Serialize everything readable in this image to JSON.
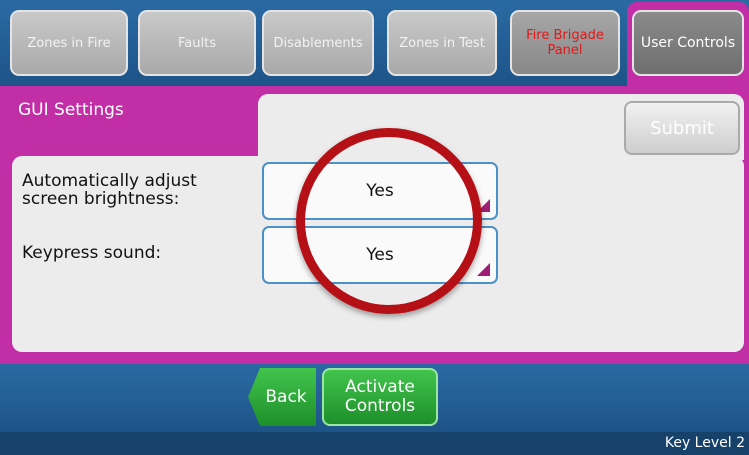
{
  "tabs": [
    {
      "label": "Zones in Fire"
    },
    {
      "label": "Faults"
    },
    {
      "label": "Disablements"
    },
    {
      "label": "Zones in Test"
    },
    {
      "label": "Fire Brigade Panel"
    },
    {
      "label": "User Controls"
    }
  ],
  "panel": {
    "title": "GUI Settings",
    "submit_label": "Submit",
    "settings": [
      {
        "label_line1": "Automatically adjust",
        "label_line2": "screen brightness:",
        "value": "Yes"
      },
      {
        "label": "Keypress sound:",
        "value": "Yes"
      }
    ]
  },
  "nav": {
    "back_label": "Back",
    "activate_line1": "Activate",
    "activate_line2": "Controls"
  },
  "status": {
    "key_level": "Key Level 2"
  },
  "colors": {
    "accent": "#c12ea5",
    "bar": "#1d5488",
    "fire_text": "#e01818",
    "annotation_circle": "#b51016",
    "green_button": "#2aa536"
  }
}
